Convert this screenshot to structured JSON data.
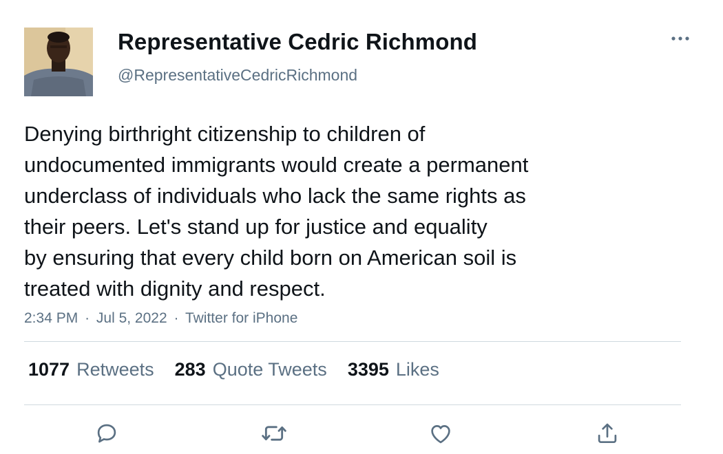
{
  "author": {
    "display_name": "Representative Cedric Richmond",
    "handle": "@RepresentativeCedricRichmond"
  },
  "tweet": {
    "text_lines": [
      "Denying birthright citizenship to children of",
      "undocumented immigrants would create a permanent",
      "underclass of individuals who lack the same rights as",
      "their peers. Let's stand up for justice and equality",
      "by ensuring that every child born on American soil is",
      "treated with dignity and respect."
    ],
    "time": "2:34 PM",
    "date": "Jul 5, 2022",
    "source": "Twitter for iPhone",
    "separator": "·"
  },
  "stats": {
    "retweets": {
      "count": "1077",
      "label": "Retweets"
    },
    "quote_tweets": {
      "count": "283",
      "label": "Quote Tweets"
    },
    "likes": {
      "count": "3395",
      "label": "Likes"
    }
  },
  "actions": {
    "reply_icon": "reply-icon",
    "retweet_icon": "retweet-icon",
    "like_icon": "heart-icon",
    "share_icon": "share-icon"
  },
  "colors": {
    "text_primary": "#0f1419",
    "text_secondary": "#5b7083",
    "divider": "#cfd9de",
    "icon": "#5b7083"
  }
}
